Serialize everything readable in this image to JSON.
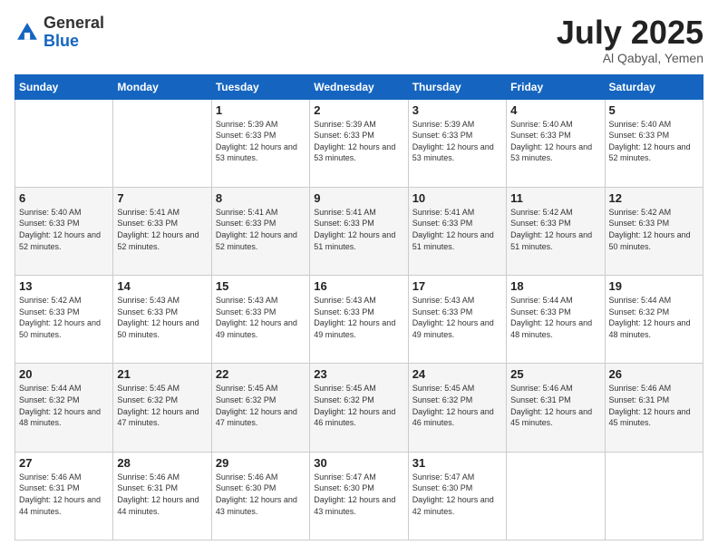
{
  "logo": {
    "general": "General",
    "blue": "Blue"
  },
  "header": {
    "month": "July 2025",
    "location": "Al Qabyal, Yemen"
  },
  "days_of_week": [
    "Sunday",
    "Monday",
    "Tuesday",
    "Wednesday",
    "Thursday",
    "Friday",
    "Saturday"
  ],
  "weeks": [
    [
      {
        "day": "",
        "sunrise": "",
        "sunset": "",
        "daylight": ""
      },
      {
        "day": "",
        "sunrise": "",
        "sunset": "",
        "daylight": ""
      },
      {
        "day": "1",
        "sunrise": "Sunrise: 5:39 AM",
        "sunset": "Sunset: 6:33 PM",
        "daylight": "Daylight: 12 hours and 53 minutes."
      },
      {
        "day": "2",
        "sunrise": "Sunrise: 5:39 AM",
        "sunset": "Sunset: 6:33 PM",
        "daylight": "Daylight: 12 hours and 53 minutes."
      },
      {
        "day": "3",
        "sunrise": "Sunrise: 5:39 AM",
        "sunset": "Sunset: 6:33 PM",
        "daylight": "Daylight: 12 hours and 53 minutes."
      },
      {
        "day": "4",
        "sunrise": "Sunrise: 5:40 AM",
        "sunset": "Sunset: 6:33 PM",
        "daylight": "Daylight: 12 hours and 53 minutes."
      },
      {
        "day": "5",
        "sunrise": "Sunrise: 5:40 AM",
        "sunset": "Sunset: 6:33 PM",
        "daylight": "Daylight: 12 hours and 52 minutes."
      }
    ],
    [
      {
        "day": "6",
        "sunrise": "Sunrise: 5:40 AM",
        "sunset": "Sunset: 6:33 PM",
        "daylight": "Daylight: 12 hours and 52 minutes."
      },
      {
        "day": "7",
        "sunrise": "Sunrise: 5:41 AM",
        "sunset": "Sunset: 6:33 PM",
        "daylight": "Daylight: 12 hours and 52 minutes."
      },
      {
        "day": "8",
        "sunrise": "Sunrise: 5:41 AM",
        "sunset": "Sunset: 6:33 PM",
        "daylight": "Daylight: 12 hours and 52 minutes."
      },
      {
        "day": "9",
        "sunrise": "Sunrise: 5:41 AM",
        "sunset": "Sunset: 6:33 PM",
        "daylight": "Daylight: 12 hours and 51 minutes."
      },
      {
        "day": "10",
        "sunrise": "Sunrise: 5:41 AM",
        "sunset": "Sunset: 6:33 PM",
        "daylight": "Daylight: 12 hours and 51 minutes."
      },
      {
        "day": "11",
        "sunrise": "Sunrise: 5:42 AM",
        "sunset": "Sunset: 6:33 PM",
        "daylight": "Daylight: 12 hours and 51 minutes."
      },
      {
        "day": "12",
        "sunrise": "Sunrise: 5:42 AM",
        "sunset": "Sunset: 6:33 PM",
        "daylight": "Daylight: 12 hours and 50 minutes."
      }
    ],
    [
      {
        "day": "13",
        "sunrise": "Sunrise: 5:42 AM",
        "sunset": "Sunset: 6:33 PM",
        "daylight": "Daylight: 12 hours and 50 minutes."
      },
      {
        "day": "14",
        "sunrise": "Sunrise: 5:43 AM",
        "sunset": "Sunset: 6:33 PM",
        "daylight": "Daylight: 12 hours and 50 minutes."
      },
      {
        "day": "15",
        "sunrise": "Sunrise: 5:43 AM",
        "sunset": "Sunset: 6:33 PM",
        "daylight": "Daylight: 12 hours and 49 minutes."
      },
      {
        "day": "16",
        "sunrise": "Sunrise: 5:43 AM",
        "sunset": "Sunset: 6:33 PM",
        "daylight": "Daylight: 12 hours and 49 minutes."
      },
      {
        "day": "17",
        "sunrise": "Sunrise: 5:43 AM",
        "sunset": "Sunset: 6:33 PM",
        "daylight": "Daylight: 12 hours and 49 minutes."
      },
      {
        "day": "18",
        "sunrise": "Sunrise: 5:44 AM",
        "sunset": "Sunset: 6:33 PM",
        "daylight": "Daylight: 12 hours and 48 minutes."
      },
      {
        "day": "19",
        "sunrise": "Sunrise: 5:44 AM",
        "sunset": "Sunset: 6:32 PM",
        "daylight": "Daylight: 12 hours and 48 minutes."
      }
    ],
    [
      {
        "day": "20",
        "sunrise": "Sunrise: 5:44 AM",
        "sunset": "Sunset: 6:32 PM",
        "daylight": "Daylight: 12 hours and 48 minutes."
      },
      {
        "day": "21",
        "sunrise": "Sunrise: 5:45 AM",
        "sunset": "Sunset: 6:32 PM",
        "daylight": "Daylight: 12 hours and 47 minutes."
      },
      {
        "day": "22",
        "sunrise": "Sunrise: 5:45 AM",
        "sunset": "Sunset: 6:32 PM",
        "daylight": "Daylight: 12 hours and 47 minutes."
      },
      {
        "day": "23",
        "sunrise": "Sunrise: 5:45 AM",
        "sunset": "Sunset: 6:32 PM",
        "daylight": "Daylight: 12 hours and 46 minutes."
      },
      {
        "day": "24",
        "sunrise": "Sunrise: 5:45 AM",
        "sunset": "Sunset: 6:32 PM",
        "daylight": "Daylight: 12 hours and 46 minutes."
      },
      {
        "day": "25",
        "sunrise": "Sunrise: 5:46 AM",
        "sunset": "Sunset: 6:31 PM",
        "daylight": "Daylight: 12 hours and 45 minutes."
      },
      {
        "day": "26",
        "sunrise": "Sunrise: 5:46 AM",
        "sunset": "Sunset: 6:31 PM",
        "daylight": "Daylight: 12 hours and 45 minutes."
      }
    ],
    [
      {
        "day": "27",
        "sunrise": "Sunrise: 5:46 AM",
        "sunset": "Sunset: 6:31 PM",
        "daylight": "Daylight: 12 hours and 44 minutes."
      },
      {
        "day": "28",
        "sunrise": "Sunrise: 5:46 AM",
        "sunset": "Sunset: 6:31 PM",
        "daylight": "Daylight: 12 hours and 44 minutes."
      },
      {
        "day": "29",
        "sunrise": "Sunrise: 5:46 AM",
        "sunset": "Sunset: 6:30 PM",
        "daylight": "Daylight: 12 hours and 43 minutes."
      },
      {
        "day": "30",
        "sunrise": "Sunrise: 5:47 AM",
        "sunset": "Sunset: 6:30 PM",
        "daylight": "Daylight: 12 hours and 43 minutes."
      },
      {
        "day": "31",
        "sunrise": "Sunrise: 5:47 AM",
        "sunset": "Sunset: 6:30 PM",
        "daylight": "Daylight: 12 hours and 42 minutes."
      },
      {
        "day": "",
        "sunrise": "",
        "sunset": "",
        "daylight": ""
      },
      {
        "day": "",
        "sunrise": "",
        "sunset": "",
        "daylight": ""
      }
    ]
  ]
}
